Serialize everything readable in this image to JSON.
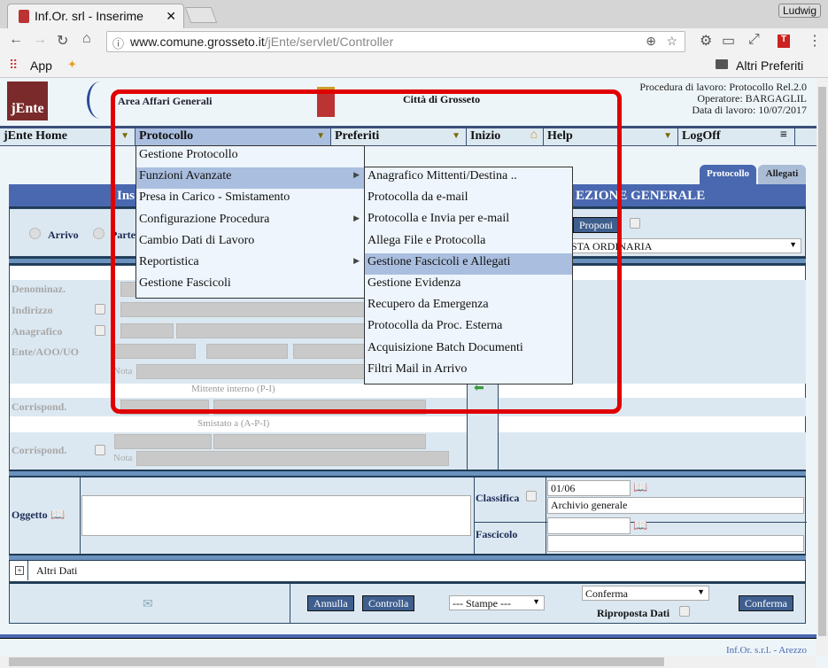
{
  "browser": {
    "tab_title": "Inf.Or. srl - Inserime",
    "user": "Ludwig",
    "url_host": "www.comune.grosseto.it",
    "url_path": "/jEnte/servlet/Controller",
    "bookmarks": {
      "apps": "App",
      "other": "Altri Preferiti"
    }
  },
  "header": {
    "logo": "jEnte",
    "area": "Area Affari Generali",
    "city": "Città di Grosseto",
    "procedure": "Procedura di lavoro: Protocollo Rel.2.0",
    "operator": "Operatore: BARGAGLIL",
    "date": "Data di lavoro: 10/07/2017"
  },
  "nav": {
    "items": [
      "jEnte Home",
      "Protocollo",
      "Preferiti",
      "Inizio",
      "Help",
      "LogOff"
    ]
  },
  "menu": {
    "items": [
      {
        "label": "Gestione Protocollo"
      },
      {
        "label": "Funzioni Avanzate",
        "sub": true
      },
      {
        "label": "Presa in Carico - Smistamento"
      },
      {
        "label": "Configurazione Procedura",
        "sub": true
      },
      {
        "label": "Cambio Dati di Lavoro"
      },
      {
        "label": "Reportistica",
        "sub": true
      },
      {
        "label": "Gestione Fascicoli"
      }
    ],
    "submenu": [
      "Anagrafico Mittenti/Destina ..",
      "Protocolla da e-mail",
      "Protocolla e Invia per e-mail",
      "Allega File e Protocolla",
      "Gestione Fascicoli e Allegati",
      "Gestione Evidenza",
      "Recupero da Emergenza",
      "Protocolla da Proc. Esterna",
      "Acquisizione Batch Documenti",
      "Filtri Mail in Arrivo"
    ]
  },
  "tabs": [
    "Protocollo",
    "Allegati"
  ],
  "form": {
    "title_left": "Ins",
    "title_right": "EZIONE GENERALE",
    "radio_arrivo": "Arrivo",
    "radio_partenza": "Parte",
    "proponi": "Proponi",
    "mezzo": "STA ORDINARIA",
    "labels": {
      "denominaz": "Denominaz.",
      "indirizzo": "Indirizzo",
      "anagrafico": "Anagrafico",
      "ente": "Ente/AOO/UO",
      "nota": "Nota",
      "mittente_interno": "Mittente interno (P-I)",
      "corrispond": "Corrispond.",
      "smistato": "Smistato a (A-P-I)"
    },
    "oggetto": "Oggetto",
    "classifica": "Classifica",
    "classifica_code": "01/06",
    "classifica_desc": "Archivio generale",
    "fascicolo": "Fascicolo",
    "altri_dati": "Altri Dati",
    "annulla": "Annulla",
    "controlla": "Controlla",
    "stampe": "--- Stampe ---",
    "conferma_select": "Conferma",
    "riproposta": "Riproposta Dati",
    "conferma": "Conferma"
  },
  "footer": "Inf.Or. s.r.l. - Arezzo",
  "colors": {
    "highlight": "#e00000",
    "menu_hl": "#aabfdf",
    "band": "#4a68b0"
  }
}
